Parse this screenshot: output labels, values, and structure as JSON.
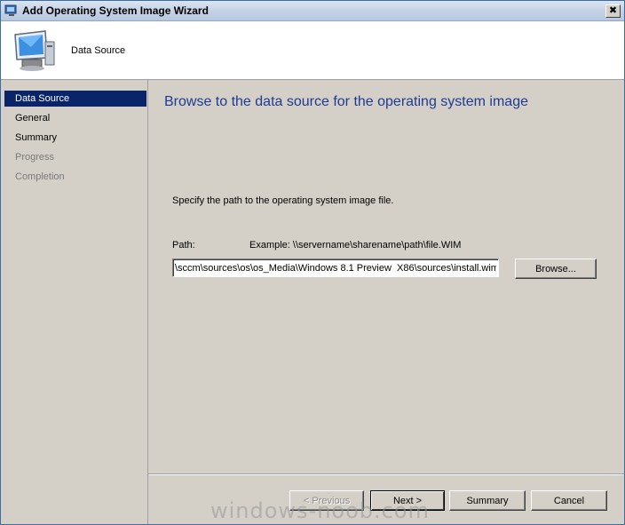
{
  "window": {
    "title": "Add Operating System Image Wizard",
    "close_glyph": "✖"
  },
  "header": {
    "title": "Data Source",
    "icon": "computer-monitor-icon"
  },
  "nav": {
    "items": [
      {
        "label": "Data Source",
        "state": "active"
      },
      {
        "label": "General",
        "state": "enabled"
      },
      {
        "label": "Summary",
        "state": "enabled"
      },
      {
        "label": "Progress",
        "state": "disabled"
      },
      {
        "label": "Completion",
        "state": "disabled"
      }
    ]
  },
  "page": {
    "heading": "Browse to the data source for the operating system image",
    "instruction": "Specify the path to the operating system image file.",
    "path_label": "Path:",
    "path_example": "Example: \\\\servername\\sharename\\path\\file.WIM",
    "path_value": "\\sccm\\sources\\os\\os_Media\\Windows 8.1 Preview  X86\\sources\\install.wim",
    "browse_label": "Browse..."
  },
  "footer": {
    "previous_label": "< Previous",
    "next_label": "Next >",
    "summary_label": "Summary",
    "cancel_label": "Cancel"
  },
  "watermark": "windows-noob.com",
  "colors": {
    "nav_active_bg": "#0a246a",
    "heading": "#1f3a93",
    "dialog_bg": "#d4d0c8"
  }
}
